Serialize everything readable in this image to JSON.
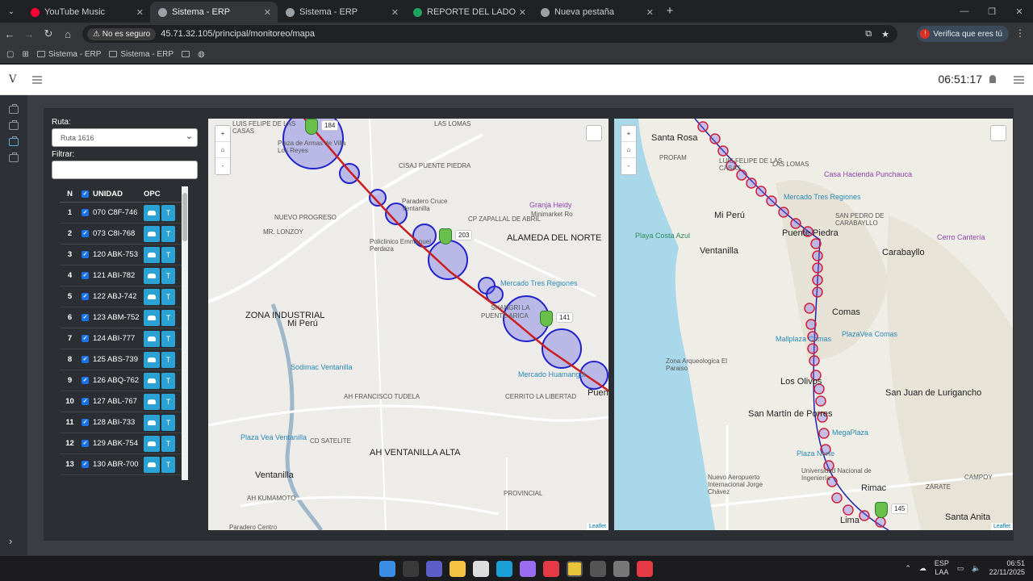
{
  "browser": {
    "tabs": [
      {
        "title": "YouTube Music",
        "color": "#ff0033",
        "active": false
      },
      {
        "title": "Sistema - ERP",
        "color": "#9aa0a6",
        "active": true
      },
      {
        "title": "Sistema - ERP",
        "color": "#9aa0a6",
        "active": false
      },
      {
        "title": "REPORTE DEL LADO A VIPUSA",
        "color": "#1ea362",
        "active": false
      },
      {
        "title": "Nueva pestaña",
        "color": "#9aa0a6",
        "active": false
      }
    ],
    "new_tab": "+",
    "security_label": "No es seguro",
    "url": "45.71.32.105/principal/monitoreo/mapa",
    "verify_label": "Verifica que eres tú",
    "bookmarks": [
      "Sistema - ERP",
      "Sistema - ERP"
    ]
  },
  "app": {
    "logo": "V",
    "clock": "06:51:17"
  },
  "filters": {
    "route_label": "Ruta:",
    "route_value": "Ruta 1616",
    "filter_label": "Filtrar:",
    "filter_value": ""
  },
  "table": {
    "headers": {
      "n": "N",
      "unidad": "UNIDAD",
      "opc": "OPC"
    },
    "rows": [
      {
        "n": "1",
        "unidad": "070 C8F-746",
        "t": "T"
      },
      {
        "n": "2",
        "unidad": "073 C8I-768",
        "t": "T"
      },
      {
        "n": "3",
        "unidad": "120 ABK-753",
        "t": "T"
      },
      {
        "n": "4",
        "unidad": "121 ABI-782",
        "t": "T"
      },
      {
        "n": "5",
        "unidad": "122 ABJ-742",
        "t": "T"
      },
      {
        "n": "6",
        "unidad": "123 ABM-752",
        "t": "T"
      },
      {
        "n": "7",
        "unidad": "124 ABI-777",
        "t": "T"
      },
      {
        "n": "8",
        "unidad": "125 ABS-739",
        "t": "T"
      },
      {
        "n": "9",
        "unidad": "126 ABQ-762",
        "t": "T"
      },
      {
        "n": "10",
        "unidad": "127 ABL-767",
        "t": "T"
      },
      {
        "n": "11",
        "unidad": "128 ABI-733",
        "t": "T"
      },
      {
        "n": "12",
        "unidad": "129 ABK-754",
        "t": "T"
      },
      {
        "n": "13",
        "unidad": "130 ABR-700",
        "t": "T"
      }
    ]
  },
  "map1": {
    "zoom_in": "+",
    "zoom_out": "-",
    "attribution": "Leaflet",
    "bus_labels": [
      "184",
      "203",
      "141"
    ],
    "labels": [
      {
        "text": "LUIS FELIPE DE LAS CASAS",
        "cls": "",
        "key": "l1"
      },
      {
        "text": "LAS LOMAS",
        "cls": "",
        "key": "l2"
      },
      {
        "text": "Plaza de Armas de Villa Los Reyes",
        "cls": "",
        "key": "l3"
      },
      {
        "text": "CISAJ PUENTE PIEDRA",
        "cls": "",
        "key": "l4"
      },
      {
        "text": "Paradero Cruce Ventanilla",
        "cls": "",
        "key": "l5"
      },
      {
        "text": "CP ZAPALLAL DE ABRIL",
        "cls": "",
        "key": "l6"
      },
      {
        "text": "Granja Heidy",
        "cls": "poip",
        "key": "l7"
      },
      {
        "text": "Minimarket Ro",
        "cls": "",
        "key": "l8"
      },
      {
        "text": "NUEVO PROGRESO",
        "cls": "",
        "key": "l9"
      },
      {
        "text": "MR. LONZOY",
        "cls": "",
        "key": "l10"
      },
      {
        "text": "Policlinico Emmanuel Perdaza",
        "cls": "",
        "key": "l11"
      },
      {
        "text": "ALAMEDA DEL NORTE",
        "cls": "big",
        "key": "l12"
      },
      {
        "text": "Mercado Tres Regiones",
        "cls": "poi",
        "key": "l13"
      },
      {
        "text": "ZONA INDUSTRIAL",
        "cls": "big",
        "key": "l14"
      },
      {
        "text": "Mi Perú",
        "cls": "big",
        "key": "l15"
      },
      {
        "text": "SHANGRI LA",
        "cls": "",
        "key": "l16"
      },
      {
        "text": "PUENTE ARICA",
        "cls": "",
        "key": "l17"
      },
      {
        "text": "Mercado Huamangui",
        "cls": "poi",
        "key": "l18"
      },
      {
        "text": "Sodimac Ventanilla",
        "cls": "poi",
        "key": "l19"
      },
      {
        "text": "CERRITO LA LIBERTAD",
        "cls": "",
        "key": "l20"
      },
      {
        "text": "AH FRANCISCO TUDELA",
        "cls": "",
        "key": "l21"
      },
      {
        "text": "Plaza Vea Ventanilla",
        "cls": "poi",
        "key": "l22"
      },
      {
        "text": "CD SATELITE",
        "cls": "",
        "key": "l23"
      },
      {
        "text": "AH VENTANILLA ALTA",
        "cls": "big",
        "key": "l24"
      },
      {
        "text": "Ventanilla",
        "cls": "big",
        "key": "l25"
      },
      {
        "text": "AH KUMAMOTO",
        "cls": "",
        "key": "l26"
      },
      {
        "text": "Paradero Centro",
        "cls": "",
        "key": "l27"
      },
      {
        "text": "PROVINCIAL",
        "cls": "",
        "key": "l28"
      },
      {
        "text": "Puen",
        "cls": "big",
        "key": "l29"
      }
    ]
  },
  "map2": {
    "zoom_in": "+",
    "zoom_out": "-",
    "attribution": "Leaflet",
    "bus_labels": [
      "145"
    ],
    "labels": [
      {
        "text": "Santa Rosa",
        "cls": "big",
        "key": "m1"
      },
      {
        "text": "PROFAM",
        "cls": "",
        "key": "m2"
      },
      {
        "text": "LUIS FELIPE DE LAS CASAS",
        "cls": "",
        "key": "m3"
      },
      {
        "text": "LAS LOMAS",
        "cls": "",
        "key": "m4"
      },
      {
        "text": "Casa Hacienda Punchauca",
        "cls": "poip",
        "key": "m5"
      },
      {
        "text": "Mercado Tres Regiones",
        "cls": "poi",
        "key": "m6"
      },
      {
        "text": "Mi Perú",
        "cls": "big",
        "key": "m7"
      },
      {
        "text": "Puente Piedra",
        "cls": "big",
        "key": "m8"
      },
      {
        "text": "SAN PEDRO DE CARABAYLLO",
        "cls": "",
        "key": "m9"
      },
      {
        "text": "Playa Costa Azul",
        "cls": "poig",
        "key": "m10"
      },
      {
        "text": "Ventanilla",
        "cls": "big",
        "key": "m11"
      },
      {
        "text": "Carabayllo",
        "cls": "big",
        "key": "m12"
      },
      {
        "text": "Cerro Cantería",
        "cls": "poip",
        "key": "m13"
      },
      {
        "text": "Comas",
        "cls": "big",
        "key": "m14"
      },
      {
        "text": "Mallplaza Comas",
        "cls": "poi",
        "key": "m15"
      },
      {
        "text": "PlazaVea Comas",
        "cls": "poi",
        "key": "m16"
      },
      {
        "text": "Zona Arqueologica El Paraiso",
        "cls": "",
        "key": "m17"
      },
      {
        "text": "Los Olivos",
        "cls": "big",
        "key": "m18"
      },
      {
        "text": "San Juan de Lurigancho",
        "cls": "big",
        "key": "m19"
      },
      {
        "text": "San Martín de Porres",
        "cls": "big",
        "key": "m20"
      },
      {
        "text": "MegaPlaza",
        "cls": "poi",
        "key": "m21"
      },
      {
        "text": "Plaza Norte",
        "cls": "poi",
        "key": "m22"
      },
      {
        "text": "Universidad Nacional de Ingeniería",
        "cls": "",
        "key": "m23"
      },
      {
        "text": "Nuevo Aeropuerto Internacional Jorge Chávez",
        "cls": "",
        "key": "m24"
      },
      {
        "text": "Rimac",
        "cls": "big",
        "key": "m25"
      },
      {
        "text": "Santa Anita",
        "cls": "big",
        "key": "m26"
      },
      {
        "text": "Lima",
        "cls": "big",
        "key": "m27"
      },
      {
        "text": "ZÁRATE",
        "cls": "",
        "key": "m28"
      },
      {
        "text": "CAMPOY",
        "cls": "",
        "key": "m29"
      }
    ]
  },
  "taskbar": {
    "lang1": "ESP",
    "lang2": "LAA",
    "time": "06:51",
    "date": "22/11/2025"
  }
}
